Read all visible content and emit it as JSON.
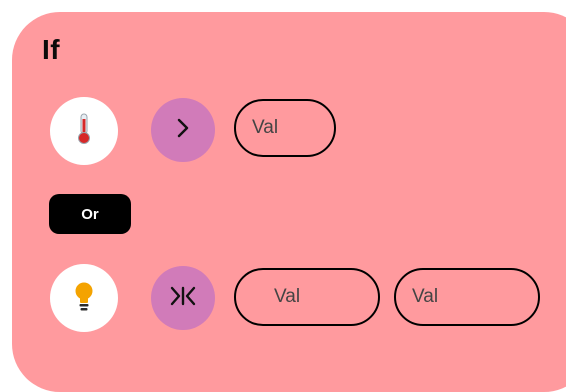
{
  "condition": {
    "title": "If",
    "accent_color": "#FF9A9E",
    "operator_color": "#D17BB9",
    "rows": [
      {
        "icon": "thermometer-icon",
        "operator": "greater-than",
        "operator_symbol": ">",
        "values": [
          "Val"
        ]
      },
      {
        "icon": "lightbulb-icon",
        "operator": "between",
        "operator_symbol": ">|<",
        "values": [
          "Val",
          "Val"
        ]
      }
    ],
    "logic_label": "Or"
  }
}
